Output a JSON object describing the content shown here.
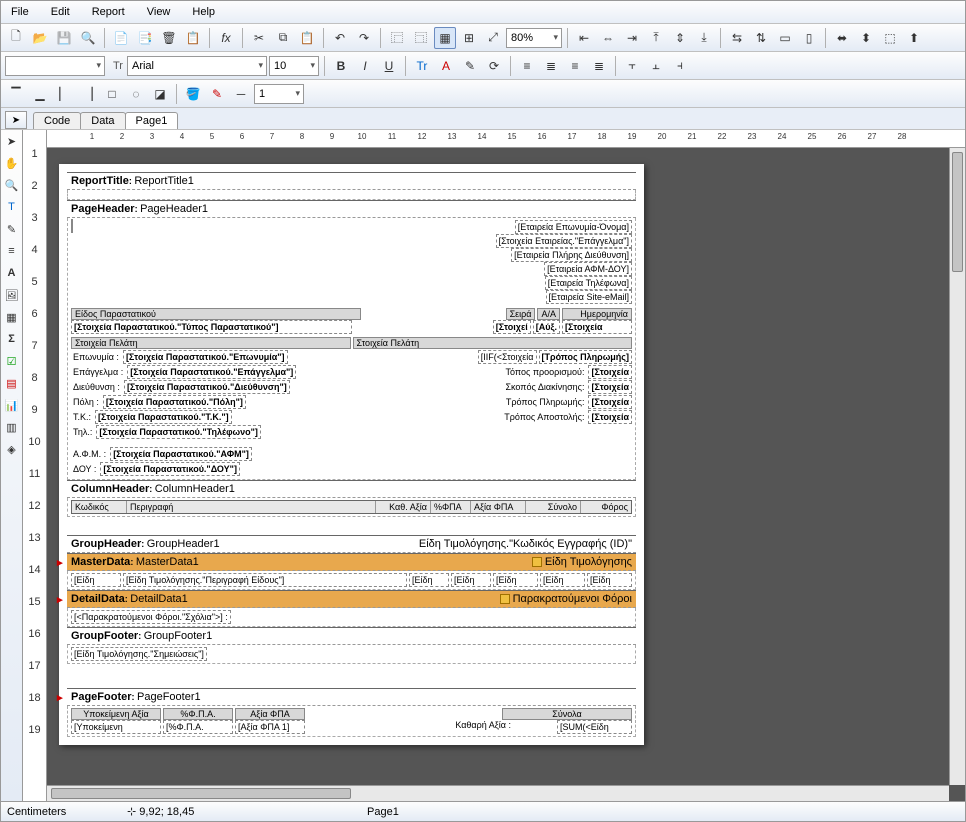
{
  "menu": {
    "file": "File",
    "edit": "Edit",
    "report": "Report",
    "view": "View",
    "help": "Help"
  },
  "toolbar": {
    "zoom": "80%",
    "font": "Arial",
    "fontprefix": "Tr",
    "fontsize": "10",
    "spinval": "1"
  },
  "tabs": {
    "code": "Code",
    "data": "Data",
    "page1": "Page1"
  },
  "ruler": {
    "h": [
      " ",
      "1",
      "2",
      "3",
      "4",
      "5",
      "6",
      "7",
      "8",
      "9",
      "10",
      "11",
      "12",
      "13",
      "14",
      "15",
      "16",
      "17",
      "18",
      "19",
      "20",
      "21",
      "22",
      "23",
      "24",
      "25",
      "26",
      "27",
      "28"
    ],
    "v": [
      "1",
      "2",
      "3",
      "4",
      "5",
      "6",
      "7",
      "8",
      "9",
      "10",
      "11",
      "12",
      "13",
      "14",
      "15",
      "16",
      "17",
      "18",
      "19"
    ]
  },
  "bands": {
    "reporttitle": {
      "label": "ReportTitle",
      "name": "ReportTitle1"
    },
    "pageheader": {
      "label": "PageHeader",
      "name": "PageHeader1"
    },
    "columnheader": {
      "label": "ColumnHeader",
      "name": "ColumnHeader1"
    },
    "groupheader": {
      "label": "GroupHeader",
      "name": "GroupHeader1",
      "cond": "Είδη Τιμολόγησης.\"Κωδικός Εγγραφής (ID)\""
    },
    "masterdata": {
      "label": "MasterData",
      "name": "MasterData1",
      "ds": "Είδη Τιμολόγησης"
    },
    "detaildata": {
      "label": "DetailData",
      "name": "DetailData1",
      "ds": "Παρακρατούμενοι Φόροι"
    },
    "groupfooter": {
      "label": "GroupFooter",
      "name": "GroupFooter1"
    },
    "pagefooter": {
      "label": "PageFooter",
      "name": "PageFooter1"
    }
  },
  "company": {
    "line1": "[Εταιρεία Επωνυμία-Όνομα]",
    "line2": "[Στοιχεία Εταιρείας.\"Επάγγελμα\"]",
    "line3": "[Εταιρεία Πλήρης Διεύθυνση]",
    "line4": "[Εταιρεία ΑΦΜ-ΔΟΥ]",
    "line5": "[Εταιρεία Τηλέφωνα]",
    "line6": "[Εταιρεία Site-eMail]"
  },
  "docrow": {
    "kind": "Είδος Παραστατικού",
    "series": "Σειρά",
    "aa": "A/A",
    "date": "Ημερομηνία",
    "kindval": "[Στοιχεία Παραστατικού.\"Τύπος Παραστατικού\"]",
    "seriesval": "[Στοιχεί",
    "aaval": "[Αύξ.",
    "dateval": "[Στοιχεία"
  },
  "client": {
    "hdrL": "Στοιχεία Πελάτη",
    "hdrR": "Στοιχεία Πελάτη",
    "name_l": "Επωνυμία :",
    "name_v": "[Στοιχεία Παραστατικού.\"Επωνυμία\"]",
    "job_l": "Επάγγελμα :",
    "job_v": "[Στοιχεία Παραστατικού.\"Επάγγελμα\"]",
    "addr_l": "Διεύθυνση :",
    "addr_v": "[Στοιχεία Παραστατικού.\"Διεύθυνση\"]",
    "city_l": "Πόλη :",
    "city_v": "[Στοιχεία Παραστατικού.\"Πόλη\"]",
    "tk_l": "T.K.:",
    "tk_v": "[Στοιχεία Παραστατικού.\"T.K.\"]",
    "tel_l": "Τηλ.:",
    "tel_v": "[Στοιχεία Παραστατικού.\"Τηλέφωνο\"]",
    "afm_l": "Α.Φ.Μ. :",
    "afm_v": "[Στοιχεία Παραστατικού.\"ΑΦΜ\"]",
    "doy_l": "ΔΟΥ :",
    "doy_v": "[Στοιχεία Παραστατικού.\"ΔΟΥ\"]",
    "iif": "[IIF(<Στοιχεία",
    "paymode": "[Τρόπος Πληρωμής]",
    "dest_l": "Τόπος προορισμού:",
    "dest_v": "[Στοιχεία",
    "move_l": "Σκοπός Διακίνησης:",
    "move_v": "[Στοιχεία",
    "pay_l": "Τρόπος Πληρωμής:",
    "pay_v": "[Στοιχεία",
    "ship_l": "Τρόπος Αποστολής:",
    "ship_v": "[Στοιχεία"
  },
  "cols": {
    "c1": "Κωδικός",
    "c2": "Περιγραφή",
    "c3": "Καθ. Αξία",
    "c4": "%ΦΠΑ",
    "c5": "Αξία ΦΠΑ",
    "c6": "Σύνολο",
    "c7": "Φόρος"
  },
  "master": {
    "f1": "[Είδη",
    "f2": "[Είδη Τιμολόγησης.\"Περιγραφή Είδους\"]",
    "f3": "[Είδη",
    "f4": "[Είδη",
    "f5": "[Είδη",
    "f6": "[Είδη",
    "f7": "[Είδη"
  },
  "detail": {
    "text": "[<Παρακρατούμενοι Φόροι.\"Σχόλια\">] :"
  },
  "gfoot": {
    "text": "[Είδη Τιμολόγησης.\"Σημειώσεις\"]"
  },
  "pfoot": {
    "h1": "Υποκείμενη Αξία",
    "h2": "%Φ.Π.Α.",
    "h3": "Αξία ΦΠΑ",
    "h4": "Σύνολα",
    "v1": "[Υποκείμενη",
    "v2": "[%Φ.Π.Α.",
    "v3": "[Αξία ΦΠΑ 1]",
    "v4": "Καθαρή Αξία :",
    "v5": "[SUM(<Είδη"
  },
  "status": {
    "units": "Centimeters",
    "pos": "9,92; 18,45",
    "page": "Page1"
  }
}
